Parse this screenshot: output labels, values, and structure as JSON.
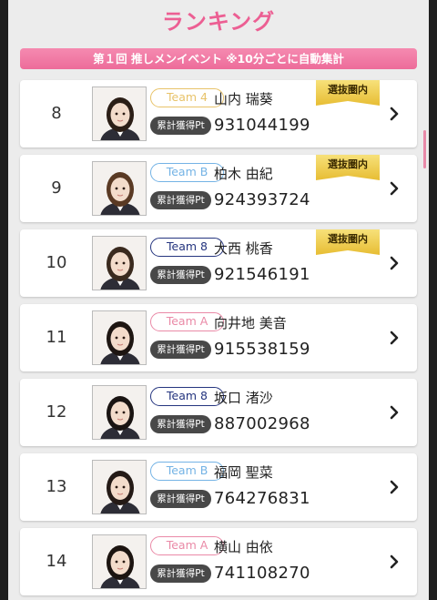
{
  "header": {
    "title": "ランキング"
  },
  "banner": {
    "text": "第１回 推しメンイベント ※10分ごとに自動集計"
  },
  "colors": {
    "accent": "#ec5f93",
    "team4": "#e8c36a",
    "teamB": "#74b3e5",
    "team8": "#25357f",
    "teamA": "#ea8aa7"
  },
  "rows": [
    {
      "rank": "8",
      "team": "Team 4",
      "team_color": "#e8c36a",
      "name": "山内 瑞葵",
      "points_label": "累計獲得Pt",
      "points": "931044199",
      "badge": "選抜圏内"
    },
    {
      "rank": "9",
      "team": "Team B",
      "team_color": "#74b3e5",
      "name": "柏木 由紀",
      "points_label": "累計獲得Pt",
      "points": "924393724",
      "badge": "選抜圏内"
    },
    {
      "rank": "10",
      "team": "Team 8",
      "team_color": "#25357f",
      "name": "大西 桃香",
      "points_label": "累計獲得Pt",
      "points": "921546191",
      "badge": "選抜圏内"
    },
    {
      "rank": "11",
      "team": "Team A",
      "team_color": "#ea8aa7",
      "name": "向井地 美音",
      "points_label": "累計獲得Pt",
      "points": "915538159",
      "badge": ""
    },
    {
      "rank": "12",
      "team": "Team 8",
      "team_color": "#25357f",
      "name": "坂口 渚沙",
      "points_label": "累計獲得Pt",
      "points": "887002968",
      "badge": ""
    },
    {
      "rank": "13",
      "team": "Team B",
      "team_color": "#74b3e5",
      "name": "福岡 聖菜",
      "points_label": "累計獲得Pt",
      "points": "764276831",
      "badge": ""
    },
    {
      "rank": "14",
      "team": "Team A",
      "team_color": "#ea8aa7",
      "name": "横山 由依",
      "points_label": "累計獲得Pt",
      "points": "741108270",
      "badge": ""
    }
  ],
  "icons": {
    "row_arrow": "chevron-right-icon",
    "member_photo": "member-photo"
  }
}
